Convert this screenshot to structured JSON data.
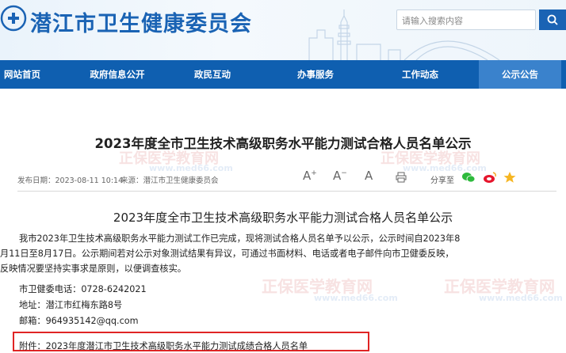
{
  "site": {
    "title": "潜江市卫生健康委员会"
  },
  "search": {
    "placeholder": "请输入搜索内容"
  },
  "nav": [
    {
      "label": "网站首页"
    },
    {
      "label": "政府信息公开"
    },
    {
      "label": "政民互动"
    },
    {
      "label": "办事服务"
    },
    {
      "label": "工作动态"
    },
    {
      "label": "公示公告"
    }
  ],
  "article": {
    "title": "2023年度全市卫生技术高级职务水平能力测试合格人员名单公示",
    "date": "发布日期：2023-08-11 10:14",
    "source": "来源：潜江市卫生健康委员会",
    "font_large": "A",
    "font_medium": "A",
    "font_small": "A",
    "share_label": "分享至",
    "subtitle": "2023年度全市卫生技术高级职务水平能力测试合格人员名单公示",
    "body_line1": "我市2023年卫生技术高级职务水平能力测试工作已完成，现将测试合格人员名单予以公示，公示时间自2023年8",
    "body_line2": "月11日至8月17日。公示期间若对公示对象测试结果有异议，可通过书面材料、电话或者电子邮件向市卫健委反映，",
    "body_line3": "反映情况要坚持实事求是原则，以便调查核实。",
    "phone": "市卫健委电话：0728-6242021",
    "address": "地址：潜江市红梅东路8号",
    "email": "邮箱：964935142@qq.com",
    "attachment_label": "附件：",
    "attachment_link": "2023年度潜江市卫生技术高级职务水平能力测试成绩合格人员名单"
  },
  "watermark": {
    "brand": "正保医学教育网",
    "url": "www.med66.com"
  },
  "colors": {
    "brand_blue": "#1a63b4",
    "nav_blue": "#0f5fb0",
    "nav_active": "#3a82cc",
    "highlight_red": "#e02424"
  }
}
